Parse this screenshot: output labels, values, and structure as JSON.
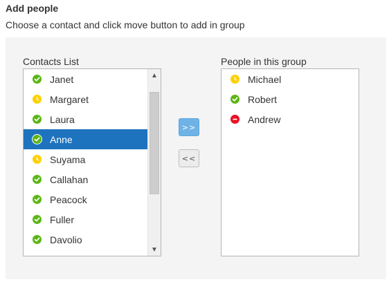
{
  "header": {
    "title": "Add people",
    "subtitle": "Choose a contact and click move button to add in group"
  },
  "contacts_list": {
    "label": "Contacts List",
    "items": [
      {
        "name": "Janet",
        "status": "available"
      },
      {
        "name": "Margaret",
        "status": "away"
      },
      {
        "name": "Laura",
        "status": "available"
      },
      {
        "name": "Anne",
        "status": "available",
        "selected": true
      },
      {
        "name": "Suyama",
        "status": "away"
      },
      {
        "name": "Callahan",
        "status": "available"
      },
      {
        "name": "Peacock",
        "status": "available"
      },
      {
        "name": "Fuller",
        "status": "available"
      },
      {
        "name": "Davolio",
        "status": "available"
      }
    ]
  },
  "group_list": {
    "label": "People in this group",
    "items": [
      {
        "name": "Michael",
        "status": "away"
      },
      {
        "name": "Robert",
        "status": "available"
      },
      {
        "name": "Andrew",
        "status": "busy"
      }
    ]
  },
  "buttons": {
    "move_right_label": ">>",
    "move_left_label": "<<"
  },
  "status_colors": {
    "available": "#5cb615",
    "away": "#ffd000",
    "busy": "#e81123"
  },
  "icons": {
    "available": "checkmark-icon",
    "away": "clock-icon",
    "busy": "minus-icon"
  }
}
